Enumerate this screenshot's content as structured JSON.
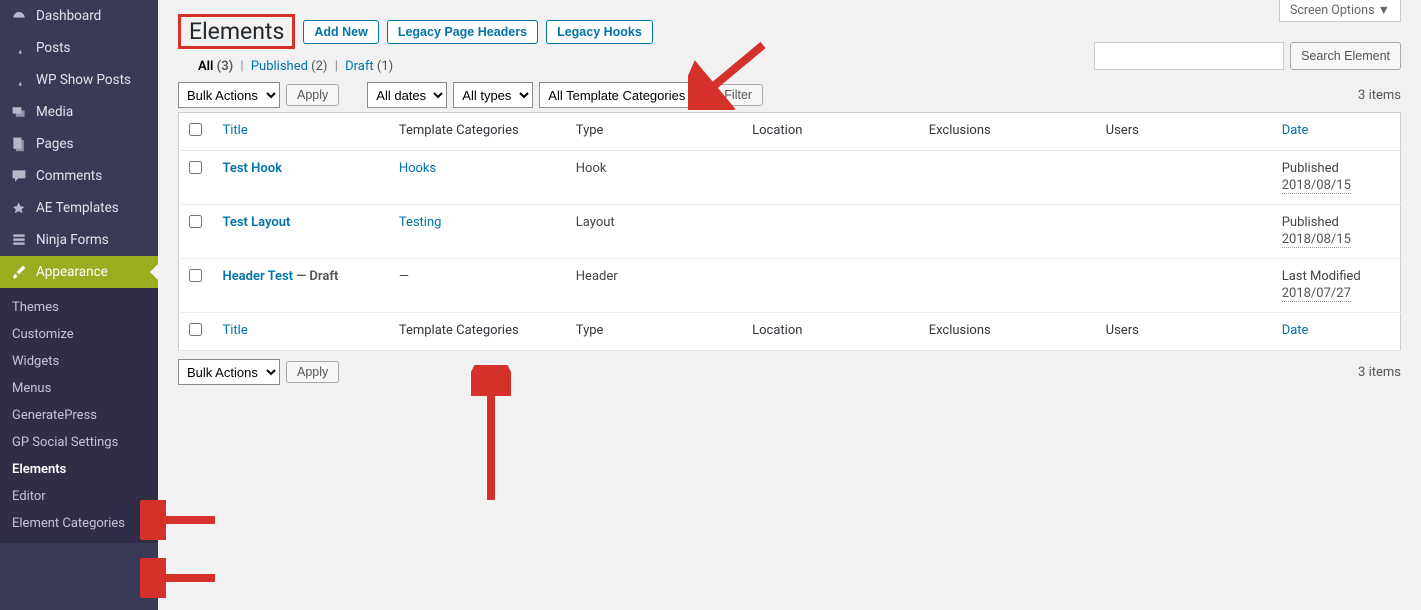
{
  "sidebar": {
    "items": [
      {
        "icon": "dashboard",
        "label": "Dashboard"
      },
      {
        "icon": "pin",
        "label": "Posts"
      },
      {
        "icon": "pin",
        "label": "WP Show Posts"
      },
      {
        "icon": "media",
        "label": "Media"
      },
      {
        "icon": "page",
        "label": "Pages"
      },
      {
        "icon": "comment",
        "label": "Comments"
      },
      {
        "icon": "template",
        "label": "AE Templates"
      },
      {
        "icon": "form",
        "label": "Ninja Forms"
      }
    ],
    "appearance": {
      "icon": "brush",
      "label": "Appearance"
    },
    "submenu": [
      {
        "label": "Themes",
        "bold": false
      },
      {
        "label": "Customize",
        "bold": false
      },
      {
        "label": "Widgets",
        "bold": false
      },
      {
        "label": "Menus",
        "bold": false
      },
      {
        "label": "GeneratePress",
        "bold": false
      },
      {
        "label": "GP Social Settings",
        "bold": false
      },
      {
        "label": "Elements",
        "bold": true
      },
      {
        "label": "Editor",
        "bold": false
      },
      {
        "label": "Element Categories",
        "bold": false
      }
    ]
  },
  "screen_options": "Screen Options ▼",
  "header": {
    "title": "Elements",
    "add_new": "Add New",
    "legacy_headers": "Legacy Page Headers",
    "legacy_hooks": "Legacy Hooks"
  },
  "views": {
    "all_label": "All",
    "all_count": "(3)",
    "published_label": "Published",
    "published_count": "(2)",
    "draft_label": "Draft",
    "draft_count": "(1)"
  },
  "filters": {
    "bulk_actions": "Bulk Actions",
    "apply": "Apply",
    "all_dates": "All dates",
    "all_types": "All types",
    "all_template_categories": "All Template Categories",
    "filter": "Filter",
    "items_count": "3 items"
  },
  "search": {
    "placeholder": "",
    "button": "Search Element"
  },
  "columns": {
    "title": "Title",
    "template_categories": "Template Categories",
    "type": "Type",
    "location": "Location",
    "exclusions": "Exclusions",
    "users": "Users",
    "date": "Date"
  },
  "rows": [
    {
      "title": "Test Hook",
      "state": "",
      "category": "Hooks",
      "category_dash": false,
      "type": "Hook",
      "date_label": "Published",
      "date_value": "2018/08/15"
    },
    {
      "title": "Test Layout",
      "state": "",
      "category": "Testing",
      "category_dash": false,
      "type": "Layout",
      "date_label": "Published",
      "date_value": "2018/08/15"
    },
    {
      "title": "Header Test",
      "state": " — Draft",
      "category": "",
      "category_dash": true,
      "type": "Header",
      "date_label": "Last Modified",
      "date_value": "2018/07/27"
    }
  ]
}
